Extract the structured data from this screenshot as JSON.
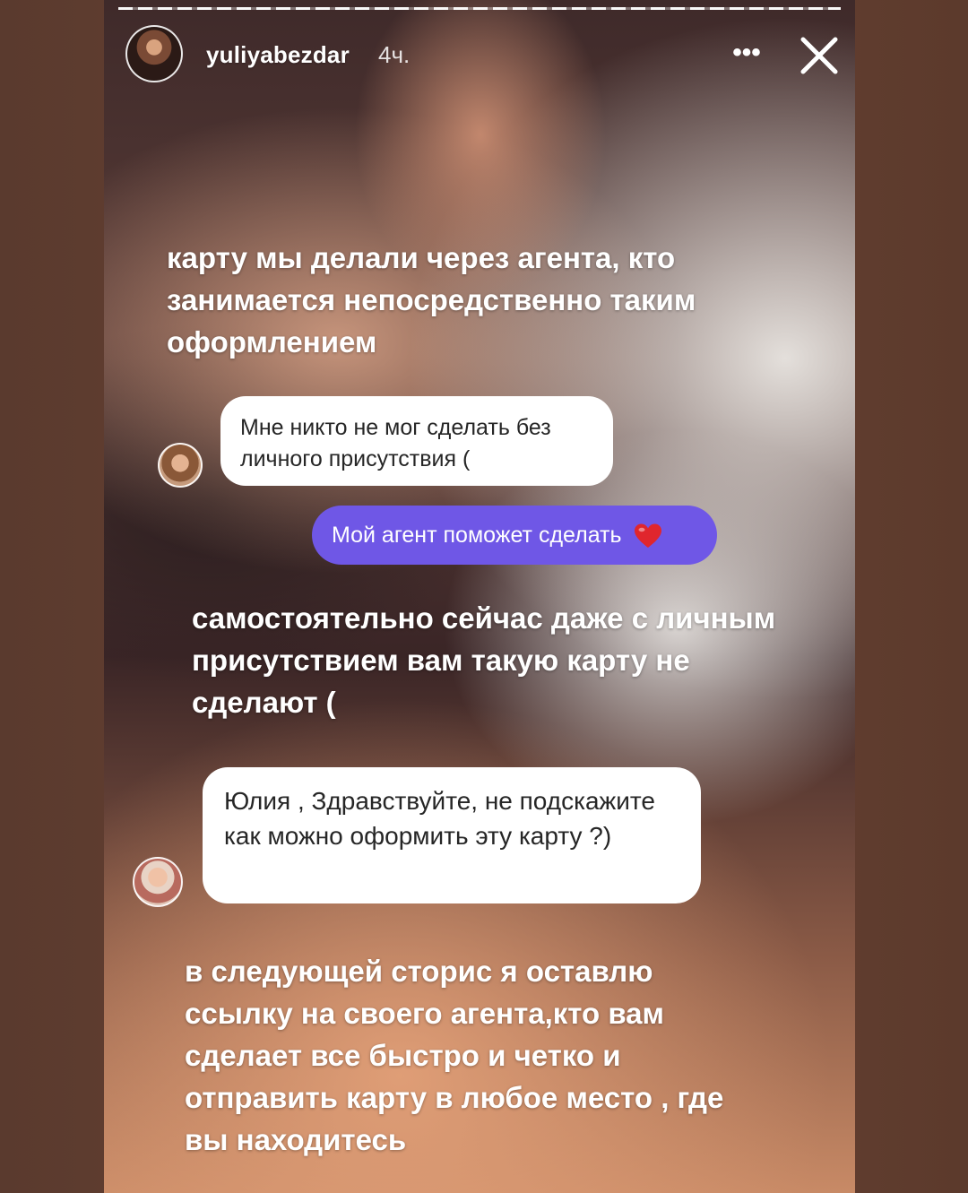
{
  "header": {
    "username": "yuliyabezdar",
    "timestamp": "4ч.",
    "more_label": "•••",
    "progress_fraction": 1.0
  },
  "story": {
    "caption_1": "карту мы делали через агента, кто занимается непосредственно таким оформлением",
    "bubble_1": "Мне никто не мог сделать без личного присутствия (",
    "bubble_me": "Мой агент поможет сделать",
    "caption_2": "самостоятельно сейчас даже с личным присутствием  вам такую карту не сделают (",
    "bubble_2": "Юлия , Здравствуйте, не подскажите как можно оформить эту карту ?)",
    "caption_3": "в следующей сторис я оставлю ссылку на своего агента,кто вам сделает все быстро и четко и отправить карту в любое место , где вы находитесь"
  },
  "icons": {
    "close": "close-icon",
    "more": "more-icon",
    "heart": "heart-icon"
  },
  "colors": {
    "sent_bubble": "#6f57e6",
    "received_bubble": "#ffffff",
    "heart": "#e0262d"
  }
}
